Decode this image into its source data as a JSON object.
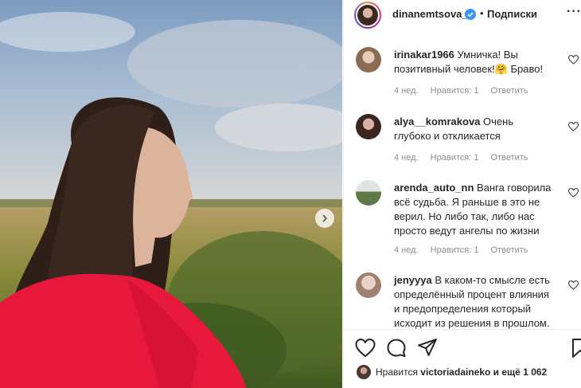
{
  "header": {
    "username": "dinanemtsova_",
    "separator": "•",
    "follow_label": "Подписки",
    "more_label": "···"
  },
  "comments": [
    {
      "username": "irinakar1966",
      "text": "Умничка! Вы позитивный человек!🤗 Браво!",
      "time": "4 нед.",
      "likes": "Нравится: 1",
      "reply": "Ответить",
      "avatar_color": "#c9a48a"
    },
    {
      "username": "alya__komrakova",
      "text": "Очень глубоко и откликается",
      "time": "4 нед.",
      "likes": "Нравится: 1",
      "reply": "Ответить",
      "avatar_color": "#5a3a30"
    },
    {
      "username": "arenda_auto_nn",
      "text": "Ванга говорила всё судьба. Я раньше в это не верил. Но либо так, либо нас просто ведут ангелы по жизни",
      "time": "4 нед.",
      "likes": "Нравится: 1",
      "reply": "Ответить",
      "avatar_color": "#7a8a6a"
    },
    {
      "username": "jenyyya",
      "text": "В каком-то смысле есть определённый процент влияния и предопределения который исходит из решения в прошлом.",
      "avatar_color": "#b89a8a"
    }
  ],
  "likes_line": {
    "prefix": "Нравится",
    "user": "victoriadaineko",
    "suffix": "и ещё 1 062"
  },
  "icons": {
    "like": "heart-icon",
    "comment": "comment-icon",
    "share": "share-icon",
    "save": "bookmark-icon",
    "next": "chevron-right-icon",
    "verified": "verified-badge-icon"
  },
  "colors": {
    "verified": "#3897f0",
    "jacket": "#e8183c",
    "text": "#262626",
    "meta": "#8e8e8e"
  }
}
